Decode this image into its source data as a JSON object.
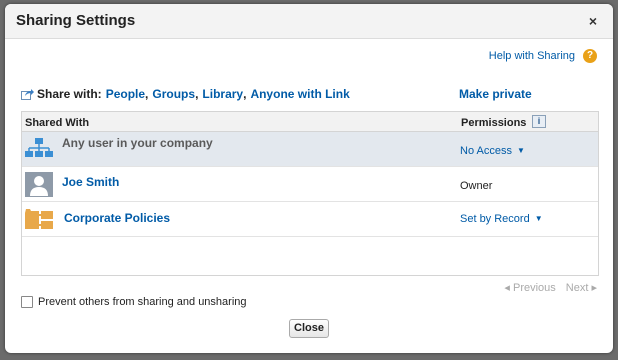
{
  "dialog": {
    "title": "Sharing Settings",
    "close_glyph": "×"
  },
  "help": {
    "label": "Help with Sharing",
    "icon_glyph": "?"
  },
  "share": {
    "prefix": "Share with:",
    "links": [
      "People",
      "Groups",
      "Library",
      "Anyone with Link"
    ],
    "make_private": "Make private"
  },
  "table": {
    "col_shared_with": "Shared With",
    "col_permissions": "Permissions",
    "info_glyph": "i",
    "rows": [
      {
        "name": "Any user in your company",
        "permission": "No Access",
        "dropdown": true,
        "icon": "org-chart-icon"
      },
      {
        "name": "Joe Smith",
        "permission": "Owner",
        "dropdown": false,
        "icon": "user-avatar-icon"
      },
      {
        "name": "Corporate Policies",
        "permission": "Set by Record",
        "dropdown": true,
        "icon": "folder-record-icon"
      }
    ]
  },
  "pager": {
    "previous": "◂ Previous",
    "next": "Next ▸"
  },
  "prevent": {
    "label": "Prevent others from sharing and unsharing",
    "checked": false
  },
  "footer": {
    "close_label": "Close"
  },
  "colors": {
    "link": "#015ba7",
    "help_icon": "#e9a118",
    "company_row_bg": "#e3e8ee"
  }
}
